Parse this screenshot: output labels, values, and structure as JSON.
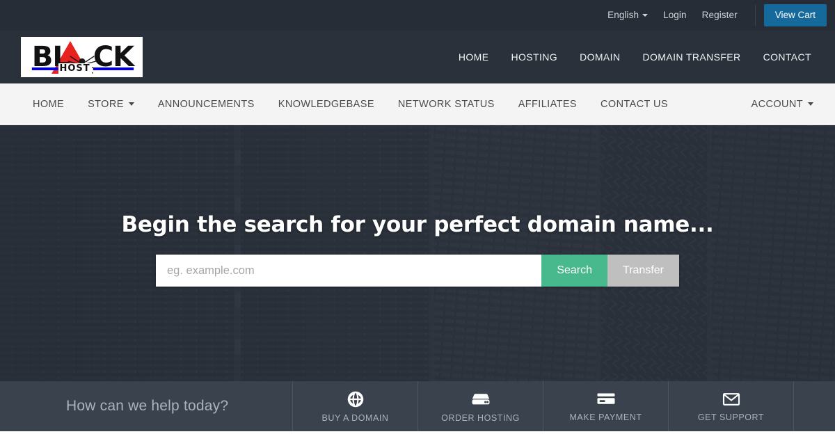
{
  "topbar": {
    "language": "English",
    "login": "Login",
    "register": "Register",
    "view_cart": "View Cart",
    "accent_color": "#16699b"
  },
  "logo": {
    "brand_main": "BL",
    "brand_tail": "CK",
    "brand_sub": "HOST",
    "triangle_color": "#e8231f",
    "full_text": "BLACK HOST"
  },
  "header": {
    "nav": [
      {
        "label": "HOME"
      },
      {
        "label": "HOSTING"
      },
      {
        "label": "DOMAIN"
      },
      {
        "label": "DOMAIN TRANSFER"
      },
      {
        "label": "CONTACT"
      }
    ],
    "background_color": "#2b313b"
  },
  "subnav": {
    "items": [
      {
        "label": "HOME",
        "caret": false
      },
      {
        "label": "STORE",
        "caret": true
      },
      {
        "label": "ANNOUNCEMENTS",
        "caret": false
      },
      {
        "label": "KNOWLEDGEBASE",
        "caret": false
      },
      {
        "label": "NETWORK STATUS",
        "caret": false
      },
      {
        "label": "AFFILIATES",
        "caret": false
      },
      {
        "label": "CONTACT US",
        "caret": false
      }
    ],
    "account": {
      "label": "ACCOUNT",
      "caret": true
    },
    "background_color": "#f4f4f4"
  },
  "hero": {
    "title": "Begin the search for your perfect domain name...",
    "search_placeholder": "eg. example.com",
    "search_value": "",
    "search_button": "Search",
    "transfer_button": "Transfer",
    "search_color": "#47b98c",
    "transfer_color": "#bfbfbf"
  },
  "helpbar": {
    "label": "How can we help today?",
    "background_color": "#3a424d",
    "items": [
      {
        "label": "BUY A DOMAIN",
        "icon": "globe-icon"
      },
      {
        "label": "ORDER HOSTING",
        "icon": "server-icon"
      },
      {
        "label": "MAKE PAYMENT",
        "icon": "credit-card-icon"
      },
      {
        "label": "GET SUPPORT",
        "icon": "envelope-icon"
      }
    ]
  }
}
